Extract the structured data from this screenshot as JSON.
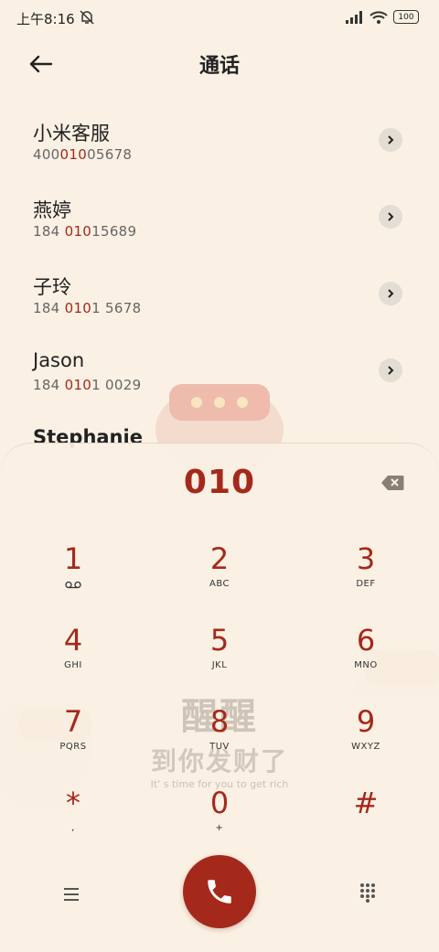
{
  "status_bar": {
    "time": "上午8:16",
    "battery": "100"
  },
  "header": {
    "title": "通话"
  },
  "contacts": [
    {
      "name": "小米客服",
      "number_before": "400",
      "number_match": "010",
      "number_after": "05678"
    },
    {
      "name": "燕婷",
      "number_before": "184 ",
      "number_match": "010",
      "number_after": "15689"
    },
    {
      "name": "子玲",
      "number_before": "184 ",
      "number_match": "010",
      "number_after": "1 5678"
    },
    {
      "name": "Jason",
      "number_before": "184 ",
      "number_match": "010",
      "number_after": "1 0029"
    },
    {
      "name": "Stephanie",
      "number_before": "",
      "number_match": "",
      "number_after": ""
    }
  ],
  "dialer": {
    "input": "010",
    "keys": [
      {
        "digit": "1",
        "letters": ""
      },
      {
        "digit": "2",
        "letters": "ABC"
      },
      {
        "digit": "3",
        "letters": "DEF"
      },
      {
        "digit": "4",
        "letters": "GHI"
      },
      {
        "digit": "5",
        "letters": "JKL"
      },
      {
        "digit": "6",
        "letters": "MNO"
      },
      {
        "digit": "7",
        "letters": "PQRS"
      },
      {
        "digit": "8",
        "letters": "TUV"
      },
      {
        "digit": "9",
        "letters": "WXYZ"
      },
      {
        "digit": "*",
        "letters": ","
      },
      {
        "digit": "0",
        "letters": "+"
      },
      {
        "digit": "#",
        "letters": ""
      }
    ]
  },
  "watermark": {
    "title": "醒醒",
    "subtitle": "到你发财了",
    "english": "It' s time for you to get rich"
  },
  "colors": {
    "accent": "#a5291b",
    "background": "#faf1e4"
  },
  "icons": {
    "back": "arrow-left-icon",
    "mute": "bell-off-icon",
    "signal": "signal-icon",
    "wifi": "wifi-icon",
    "detail": "chevron-right-icon",
    "backspace": "backspace-icon",
    "voicemail": "voicemail-icon",
    "menu": "menu-icon",
    "call": "phone-icon",
    "keypad": "dialpad-icon"
  }
}
